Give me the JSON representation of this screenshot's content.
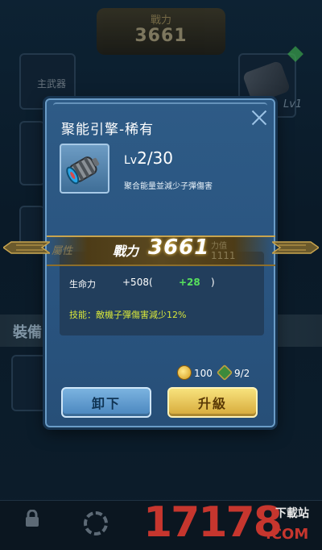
{
  "background": {
    "power_title": "戰力",
    "power_value": "3661",
    "slot_label": "主武器",
    "equip_label": "裝備",
    "side_level": "Lv1"
  },
  "dialog": {
    "title": "聚能引擎-稀有",
    "level_prefix": "Lv",
    "level": "2/30",
    "description": "聚合能量並減少子彈傷害",
    "stat": {
      "label": "生命力",
      "value": "+508(",
      "bonus": "+28",
      "close": ")"
    },
    "skill": "技能：敵機子彈傷害減少12%",
    "cost": {
      "coin": "100",
      "parts": "9/2"
    },
    "buttons": {
      "unequip": "卸下",
      "upgrade": "升級"
    }
  },
  "banner": {
    "label": "戰力",
    "value": "3661",
    "ghost_left": "屬性",
    "ghost_right_top": "力值",
    "ghost_right_bottom": "1111"
  },
  "watermark": {
    "number": "17178",
    "sub": "下載站",
    "domain": ".COM"
  },
  "colors": {
    "dialog_bg": "#2a5581",
    "bonus_green": "#57e05d",
    "skill_yellow": "#d7e63a",
    "upgrade_gold": "#e8c558",
    "unequip_blue": "#5f9bd0"
  }
}
